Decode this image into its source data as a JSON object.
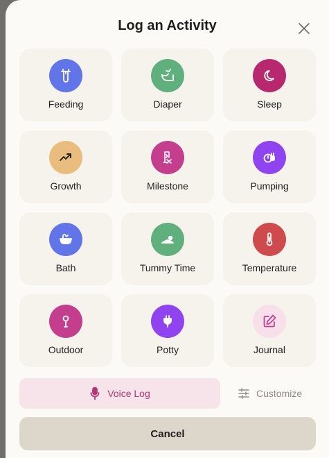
{
  "title": "Log an Activity",
  "activities": [
    {
      "label": "Feeding",
      "icon": "bottle-icon",
      "color": "#6275e8"
    },
    {
      "label": "Diaper",
      "icon": "diaper-icon",
      "color": "#5fb07d"
    },
    {
      "label": "Sleep",
      "icon": "moon-icon",
      "color": "#b8286f"
    },
    {
      "label": "Growth",
      "icon": "trend-up-icon",
      "color": "#e9bd7e"
    },
    {
      "label": "Milestone",
      "icon": "milestone-icon",
      "color": "#c33f8d"
    },
    {
      "label": "Pumping",
      "icon": "pump-icon",
      "color": "#8f44f0"
    },
    {
      "label": "Bath",
      "icon": "bathtub-icon",
      "color": "#6275e8"
    },
    {
      "label": "Tummy Time",
      "icon": "tummy-time-icon",
      "color": "#5fb07d"
    },
    {
      "label": "Temperature",
      "icon": "thermometer-icon",
      "color": "#cf4a4d"
    },
    {
      "label": "Outdoor",
      "icon": "outdoor-icon",
      "color": "#c33f8d"
    },
    {
      "label": "Potty",
      "icon": "potty-icon",
      "color": "#8f44f0"
    },
    {
      "label": "Journal",
      "icon": "pencil-square-icon",
      "color": "#f7e0e9"
    }
  ],
  "voice_log": {
    "label": "Voice Log",
    "color": "#b23576"
  },
  "customize": {
    "label": "Customize"
  },
  "cancel": {
    "label": "Cancel"
  }
}
